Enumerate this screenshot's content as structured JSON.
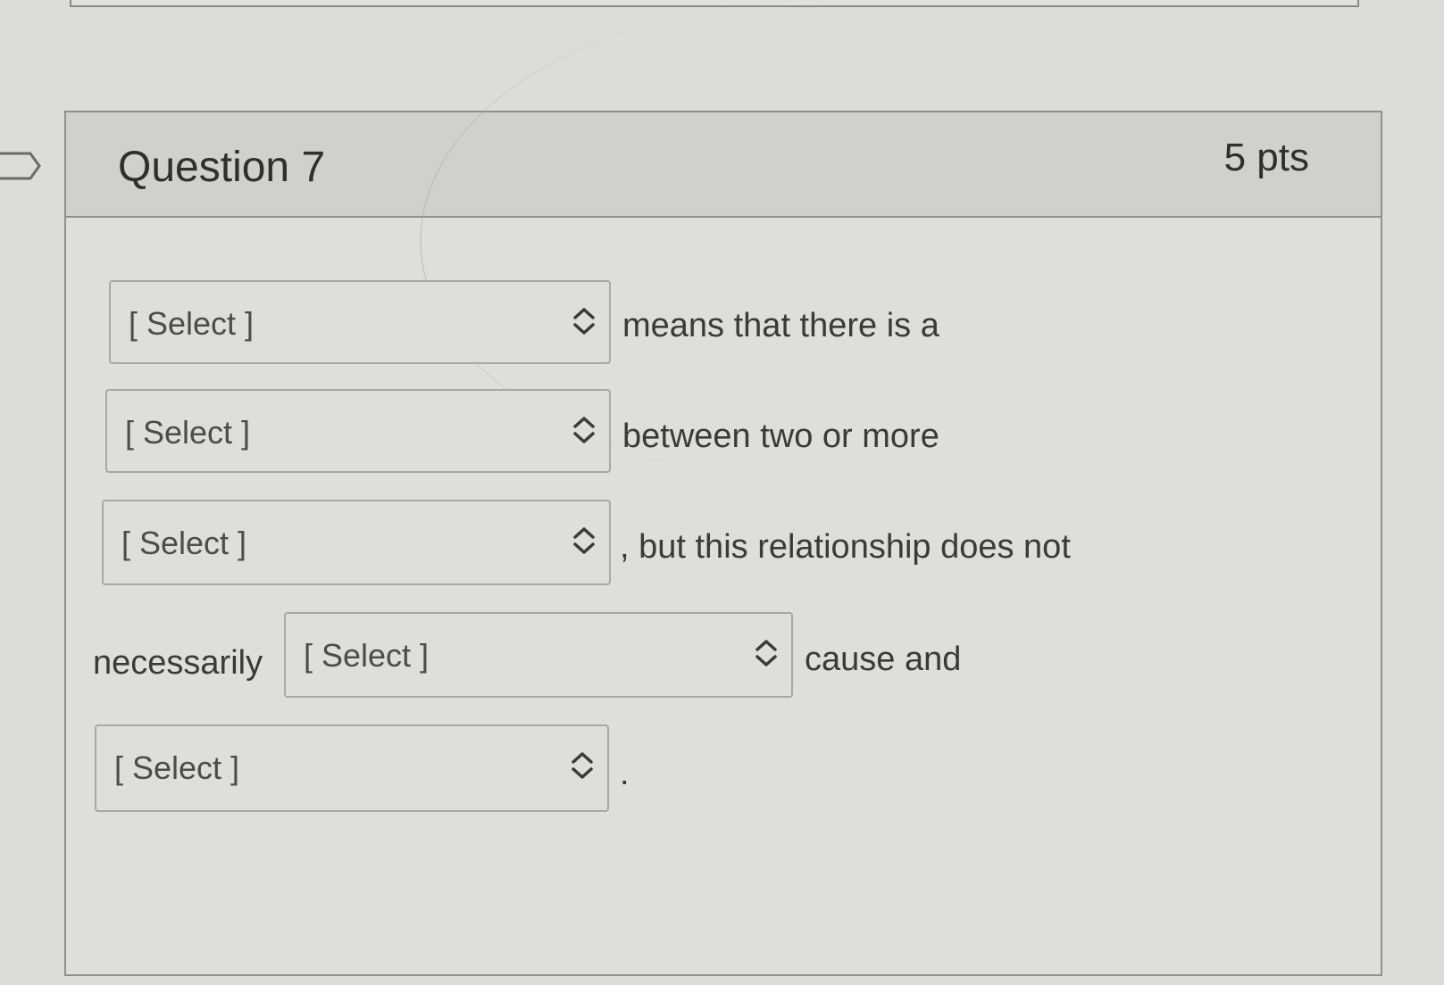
{
  "question": {
    "title": "Question 7",
    "points": "5 pts"
  },
  "dropdowns": [
    {
      "value": "[ Select ]",
      "following_text": "means that there is a"
    },
    {
      "value": "[ Select ]",
      "following_text": "between two or more"
    },
    {
      "value": "[ Select ]",
      "following_text": ", but this relationship does not"
    },
    {
      "value": "[ Select ]",
      "following_text": "cause and",
      "preceding_text": "necessarily"
    },
    {
      "value": "[ Select ]",
      "following_text": "."
    }
  ],
  "icons": {
    "bookmark": "bookmark-flag-icon",
    "dropdown": "chevron-up-down-icon"
  }
}
